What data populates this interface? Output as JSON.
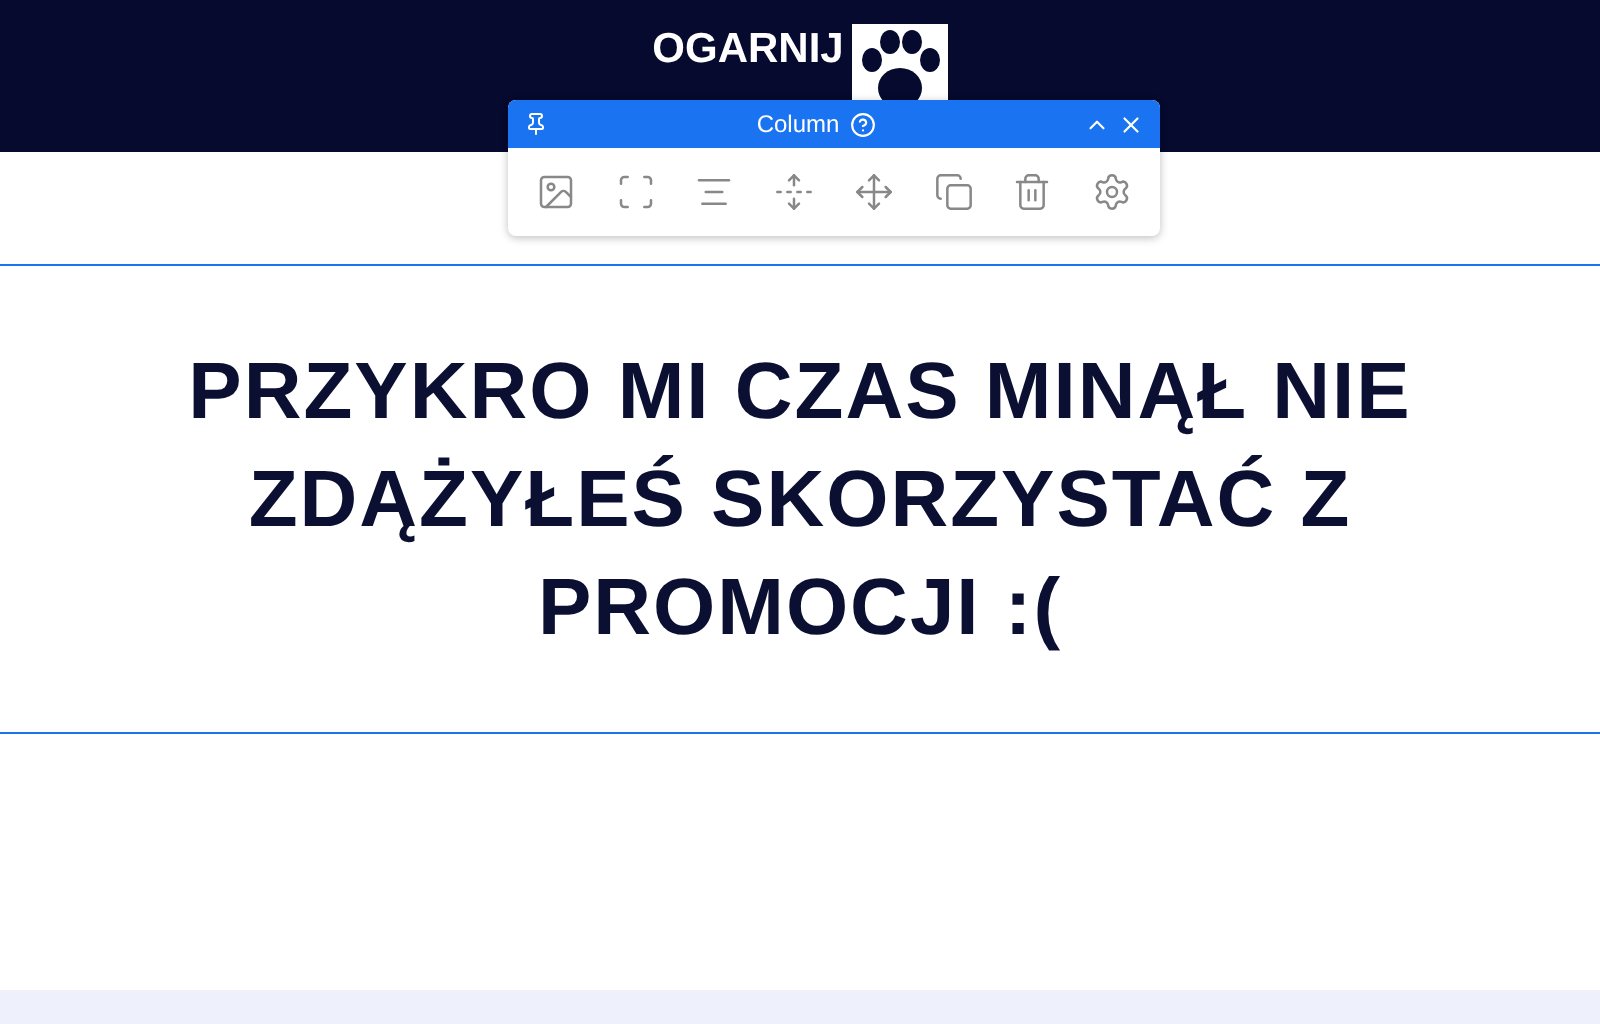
{
  "header": {
    "logo": {
      "lines": [
        "OGARNIJ"
      ]
    }
  },
  "column_toolbar": {
    "title": "Column"
  },
  "section": {
    "heading": "PRZYKRO MI CZAS MINĄŁ NIE ZDĄŻYŁEŚ SKORZYSTAĆ Z PROMOCJI :("
  }
}
